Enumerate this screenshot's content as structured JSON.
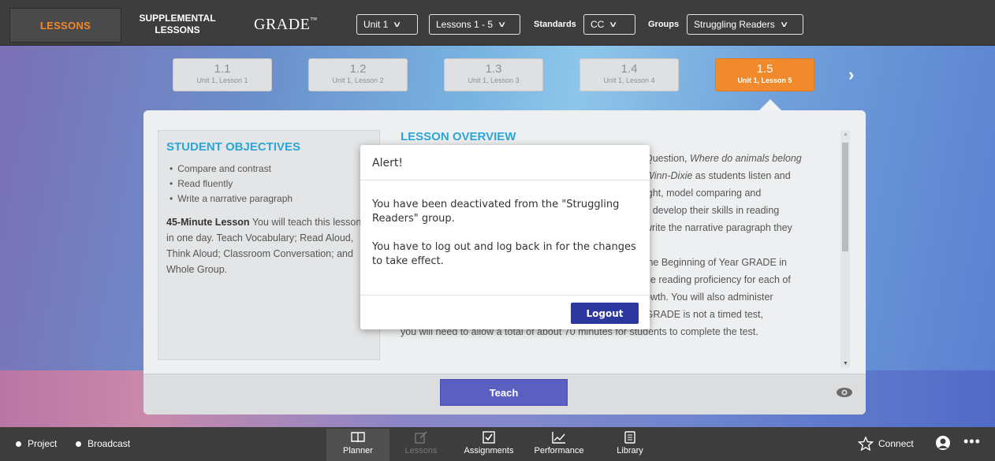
{
  "topbar": {
    "lessons_tab": "LESSONS",
    "supplemental_tab_line1": "SUPPLEMENTAL",
    "supplemental_tab_line2": "LESSONS",
    "logo": "GRADE",
    "unit_select": "Unit 1",
    "lessons_select": "Lessons 1 - 5",
    "standards_label": "Standards",
    "standards_select": "CC",
    "groups_label": "Groups",
    "groups_select": "Struggling Readers"
  },
  "lesson_tabs": [
    {
      "num": "1.1",
      "sub": "Unit 1, Lesson 1"
    },
    {
      "num": "1.2",
      "sub": "Unit 1, Lesson 2"
    },
    {
      "num": "1.3",
      "sub": "Unit 1, Lesson 3"
    },
    {
      "num": "1.4",
      "sub": "Unit 1, Lesson 4"
    },
    {
      "num": "1.5",
      "sub": "Unit 1, Lesson 5"
    }
  ],
  "objectives": {
    "title": "STUDENT OBJECTIVES",
    "items": [
      "Compare and contrast",
      "Read fluently",
      "Write a narrative paragraph"
    ],
    "lesson_bold": "45-Minute Lesson",
    "lesson_text": " You will teach this lesson in one day. Teach Vocabulary; Read Aloud, Think Aloud; Classroom Conversation; and Whole Group."
  },
  "overview": {
    "title": "LESSON OVERVIEW",
    "lines": [
      "Question, Where do animals belong",
      "Winn-Dixie as students listen and",
      "ight, model comparing and",
      "s develop their skills in reading",
      " write the narrative paragraph they",
      "",
      "the Beginning of Year GRADE in",
      "ne reading proficiency for each of",
      "owth. You will also administer",
      "GRADE at midyear and at the end of the year. Although GRADE is not a timed test,",
      "you will need to allow a total of about 70 minutes for students to complete the test."
    ]
  },
  "footer": {
    "teach_label": "Teach"
  },
  "modal": {
    "title": "Alert!",
    "message1": "You have been deactivated from the \"Struggling Readers\" group.",
    "message2": "You have to log out and log back in for the changes to take effect.",
    "logout_label": "Logout"
  },
  "bottombar": {
    "project": "Project",
    "broadcast": "Broadcast",
    "nav": [
      {
        "label": "Planner"
      },
      {
        "label": "Lessons"
      },
      {
        "label": "Assignments"
      },
      {
        "label": "Performance"
      },
      {
        "label": "Library"
      }
    ],
    "connect": "Connect",
    "more": "•••"
  },
  "colors": {
    "accent_orange": "#f08a2c",
    "heading_blue": "#2aa6d9",
    "teach_purple": "#5c5fc2",
    "logout_blue": "#2d389e"
  }
}
